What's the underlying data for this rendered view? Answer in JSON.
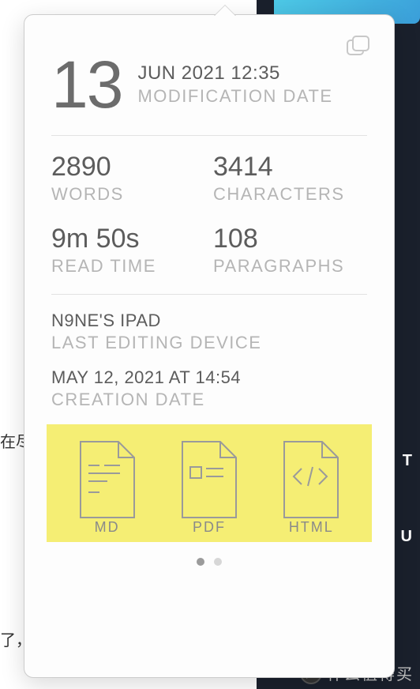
{
  "background": {
    "left_text_1": "在尽",
    "left_text_2": "了，",
    "right_text_1": "T",
    "right_text_2": "U",
    "watermark": "什么值得买",
    "watermark_badge": "值"
  },
  "popover": {
    "mod_day": "13",
    "mod_date_line": "JUN 2021 12:35",
    "mod_label": "MODIFICATION DATE",
    "stats": {
      "words_val": "2890",
      "words_label": "WORDS",
      "chars_val": "3414",
      "chars_label": "CHARACTERS",
      "read_val": "9m 50s",
      "read_label": "READ TIME",
      "para_val": "108",
      "para_label": "PARAGRAPHS"
    },
    "device_val": "N9NE'S IPAD",
    "device_label": "LAST EDITING DEVICE",
    "creation_val": "MAY 12, 2021 AT 14:54",
    "creation_label": "CREATION DATE",
    "export": {
      "md": "MD",
      "pdf": "PDF",
      "html": "HTML"
    }
  }
}
